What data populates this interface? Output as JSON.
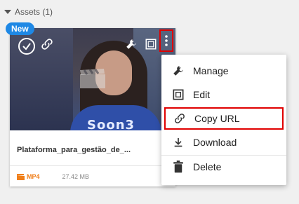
{
  "section": {
    "title": "Assets (1)"
  },
  "card": {
    "badge": "New",
    "thumbnail_shirt_text": "Soon3",
    "title": "Plataforma_para_gestão_de_...",
    "format": "MP4",
    "size": "27.42 MB"
  },
  "menu": {
    "items": [
      {
        "label": "Manage",
        "icon": "wrench-icon"
      },
      {
        "label": "Edit",
        "icon": "crop-edit-icon"
      },
      {
        "label": "Copy URL",
        "icon": "link-icon"
      },
      {
        "label": "Download",
        "icon": "download-icon"
      },
      {
        "label": "Delete",
        "icon": "trash-icon"
      }
    ]
  },
  "colors": {
    "badge": "#1e88e5",
    "highlight": "#e00000",
    "format": "#f07f1a"
  }
}
